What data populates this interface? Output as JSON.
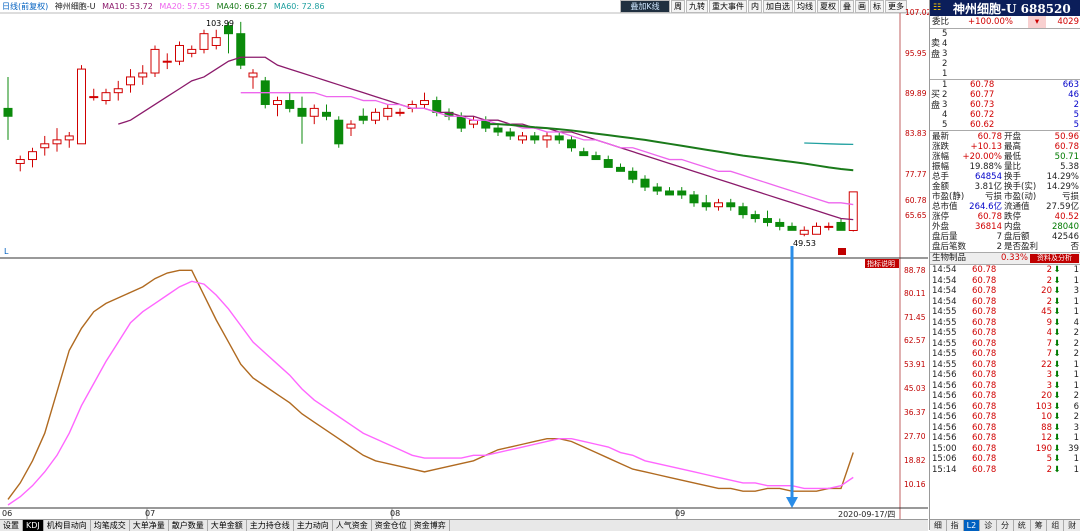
{
  "legend": {
    "period": "日线(前复权)",
    "stock": "神州细胞-U",
    "ma10": "MA10: 53.72",
    "ma20": "MA20: 57.55",
    "ma40": "MA40: 66.27",
    "ma60": "MA60: 72.86"
  },
  "toolbar": [
    "叠加K线",
    "周",
    "九转",
    "重大事件",
    "内",
    "加自选",
    "均线",
    "夏权",
    "叠",
    "画",
    "标",
    "更多"
  ],
  "kline": {
    "y_ticks": [
      "107.02",
      "95.95",
      "89.89",
      "83.83",
      "77.77",
      "71.71",
      "65.65",
      "56.71",
      "60.78"
    ],
    "high_label": "103.99",
    "low_label": "49.53",
    "marker_l": "L"
  },
  "kdj": {
    "y_ticks": [
      "88.78",
      "80.11",
      "71.45",
      "62.57",
      "53.91",
      "45.03",
      "36.37",
      "27.70",
      "18.82",
      "10.16"
    ],
    "badge": "指标说明"
  },
  "x_axis": {
    "labels": [
      "06",
      "07",
      "08",
      "09"
    ],
    "date": "2020-09-17/四"
  },
  "bottom_tabs": [
    "设置",
    "KDJ",
    "机构目动向",
    "均笔成交",
    "大单净量",
    "散户数量",
    "大单金额",
    "主力持仓线",
    "主力动向",
    "人气资金",
    "资金仓位",
    "资金博弈"
  ],
  "right": {
    "title": "神州细胞-U 688520",
    "weibi": {
      "label": "委比",
      "pct": "+100.00%",
      "val": "4029"
    },
    "sell": [
      {
        "n": "5",
        "p": "",
        "v": ""
      },
      {
        "n": "4",
        "p": "",
        "v": ""
      },
      {
        "n": "3",
        "p": "",
        "v": ""
      },
      {
        "n": "2",
        "p": "",
        "v": ""
      },
      {
        "n": "1",
        "p": "",
        "v": ""
      }
    ],
    "buy": [
      {
        "n": "1",
        "p": "60.78",
        "v": "663"
      },
      {
        "n": "2",
        "p": "60.77",
        "v": "46"
      },
      {
        "n": "3",
        "p": "60.73",
        "v": "2"
      },
      {
        "n": "4",
        "p": "60.72",
        "v": "5"
      },
      {
        "n": "5",
        "p": "60.62",
        "v": "5"
      }
    ],
    "sell_label": "卖盘",
    "buy_label": "买盘",
    "stats": [
      [
        "最新",
        "60.78",
        "开盘",
        "50.96"
      ],
      [
        "涨跌",
        "+10.13",
        "最高",
        "60.78"
      ],
      [
        "涨幅",
        "+20.00%",
        "最低",
        "50.71"
      ],
      [
        "振幅",
        "19.88%",
        "量比",
        "5.38"
      ],
      [
        "总手",
        "64854",
        "换手",
        "14.29%"
      ],
      [
        "金额",
        "3.81亿",
        "换手(实)",
        "14.29%"
      ],
      [
        "市盈(静)",
        "亏损",
        "市盈(动)",
        "亏损"
      ],
      [
        "总市值",
        "264.6亿",
        "流通值",
        "27.59亿"
      ],
      [
        "涨停",
        "60.78",
        "跌停",
        "40.52"
      ],
      [
        "外盘",
        "36814",
        "内盘",
        "28040"
      ],
      [
        "盘后量",
        "7",
        "盘后额",
        "42546"
      ],
      [
        "盘后笔数",
        "2",
        "是否盈利",
        "否"
      ]
    ],
    "sector": {
      "name": "生物制品",
      "pct": "0.33%",
      "btn": "资料及分析"
    },
    "ticks": [
      [
        "14:54",
        "60.78",
        "2",
        "1"
      ],
      [
        "14:54",
        "60.78",
        "2",
        "1"
      ],
      [
        "14:54",
        "60.78",
        "20",
        "3"
      ],
      [
        "14:54",
        "60.78",
        "2",
        "1"
      ],
      [
        "14:55",
        "60.78",
        "45",
        "1"
      ],
      [
        "14:55",
        "60.78",
        "9",
        "4"
      ],
      [
        "14:55",
        "60.78",
        "4",
        "2"
      ],
      [
        "14:55",
        "60.78",
        "7",
        "2"
      ],
      [
        "14:55",
        "60.78",
        "7",
        "2"
      ],
      [
        "14:55",
        "60.78",
        "22",
        "1"
      ],
      [
        "14:56",
        "60.78",
        "3",
        "1"
      ],
      [
        "14:56",
        "60.78",
        "3",
        "1"
      ],
      [
        "14:56",
        "60.78",
        "20",
        "2"
      ],
      [
        "14:56",
        "60.78",
        "103",
        "6"
      ],
      [
        "14:56",
        "60.78",
        "10",
        "2"
      ],
      [
        "14:56",
        "60.78",
        "88",
        "3"
      ],
      [
        "14:56",
        "60.78",
        "12",
        "1"
      ],
      [
        "15:00",
        "60.78",
        "190",
        "39"
      ],
      [
        "15:06",
        "60.78",
        "5",
        "1"
      ],
      [
        "15:14",
        "60.78",
        "2",
        "1"
      ]
    ],
    "tabs": [
      "细",
      "指",
      "L2",
      "诊",
      "分",
      "统",
      "筹",
      "组",
      "财"
    ]
  },
  "chart_data": [
    {
      "type": "candlestick",
      "title": "",
      "ylim": [
        46,
        107.02
      ],
      "candles": [
        [
          82,
          90,
          74,
          80
        ],
        [
          68,
          66,
          70,
          69
        ],
        [
          69,
          72,
          67,
          71
        ],
        [
          72,
          75,
          70,
          73
        ],
        [
          73,
          77,
          71,
          74
        ],
        [
          74,
          76,
          72,
          75
        ],
        [
          73,
          93,
          73,
          92
        ],
        [
          85,
          87,
          84,
          85
        ],
        [
          84,
          87,
          83,
          86
        ],
        [
          86,
          89,
          84,
          87
        ],
        [
          88,
          92,
          86,
          90
        ],
        [
          90,
          93,
          88,
          91
        ],
        [
          91,
          98,
          90,
          97
        ],
        [
          94,
          96,
          92,
          94
        ],
        [
          94,
          99,
          93,
          98
        ],
        [
          96,
          98,
          95,
          97
        ],
        [
          97,
          102,
          96,
          101
        ],
        [
          98,
          102,
          97,
          100
        ],
        [
          103,
          104,
          96,
          101
        ],
        [
          101,
          104,
          92,
          93
        ],
        [
          90,
          92,
          87,
          91
        ],
        [
          89,
          90,
          82,
          83
        ],
        [
          83,
          85,
          80,
          84
        ],
        [
          84,
          86,
          81,
          82
        ],
        [
          82,
          85,
          73,
          80
        ],
        [
          80,
          83,
          78,
          82
        ],
        [
          81,
          83,
          79,
          80
        ],
        [
          79,
          80,
          72,
          73
        ],
        [
          77,
          79,
          75,
          78
        ],
        [
          80,
          82,
          78,
          79
        ],
        [
          79,
          82,
          78,
          81
        ],
        [
          80,
          83,
          79,
          82
        ],
        [
          81,
          82,
          80,
          81
        ],
        [
          82,
          84,
          81,
          83
        ],
        [
          83,
          86,
          82,
          84
        ],
        [
          84,
          85,
          80,
          81
        ],
        [
          81,
          82,
          79,
          80
        ],
        [
          80,
          81,
          76,
          77
        ],
        [
          78,
          80,
          77,
          79
        ],
        [
          79,
          80,
          76,
          77
        ],
        [
          77,
          78,
          75,
          76
        ],
        [
          76,
          77,
          74,
          75
        ],
        [
          74,
          76,
          73,
          75
        ],
        [
          75,
          76,
          73,
          74
        ],
        [
          74,
          76,
          72,
          75
        ],
        [
          75,
          76,
          73,
          74
        ],
        [
          74,
          75,
          71,
          72
        ],
        [
          71,
          72,
          70,
          70
        ],
        [
          70,
          71,
          69,
          69
        ],
        [
          69,
          70,
          67,
          67
        ],
        [
          67,
          68,
          66,
          66
        ],
        [
          66,
          67,
          63,
          64
        ],
        [
          64,
          65,
          61,
          62
        ],
        [
          62,
          63,
          60,
          61
        ],
        [
          61,
          62,
          60,
          60
        ],
        [
          61,
          62,
          59,
          60
        ],
        [
          60,
          61,
          57,
          58
        ],
        [
          58,
          60,
          56,
          57
        ],
        [
          57,
          59,
          56,
          58
        ],
        [
          58,
          59,
          56,
          57
        ],
        [
          57,
          58,
          54,
          55
        ],
        [
          55,
          56,
          53,
          54
        ],
        [
          54,
          56,
          52,
          53
        ],
        [
          53,
          54,
          51,
          52
        ],
        [
          52,
          53,
          51,
          51
        ],
        [
          50,
          52,
          49.5,
          51
        ],
        [
          50,
          53,
          50,
          52
        ],
        [
          52,
          53,
          51,
          52
        ],
        [
          53,
          54,
          51,
          51
        ],
        [
          50.96,
          60.78,
          50.71,
          60.78
        ]
      ],
      "series": [
        {
          "name": "MA10",
          "color": "#8b1a6b",
          "values": [
            null,
            null,
            null,
            null,
            null,
            null,
            null,
            null,
            null,
            78,
            79,
            81,
            83,
            85,
            87,
            89,
            90,
            92,
            94,
            95,
            95,
            95,
            93,
            92,
            91,
            90,
            89,
            88,
            87,
            86,
            85,
            84,
            83,
            82,
            82,
            81,
            81,
            80,
            80,
            79,
            79,
            78,
            78,
            77,
            77,
            76,
            76,
            75,
            74,
            73,
            72,
            71,
            70,
            69,
            68,
            67,
            66,
            65,
            64,
            63,
            62,
            61,
            60,
            59,
            58,
            57,
            56,
            55,
            54,
            53.72
          ]
        },
        {
          "name": "MA20",
          "color": "#ee66ee",
          "values": [
            null,
            null,
            null,
            null,
            null,
            null,
            null,
            null,
            null,
            null,
            null,
            null,
            null,
            null,
            null,
            null,
            null,
            null,
            null,
            86,
            86,
            86,
            86,
            86,
            86,
            86,
            85,
            85,
            85,
            84,
            84,
            83,
            83,
            82,
            82,
            81,
            80,
            80,
            79,
            79,
            78,
            78,
            77,
            77,
            76,
            76,
            75,
            74,
            74,
            73,
            72,
            72,
            71,
            70,
            69,
            69,
            68,
            67,
            66,
            66,
            65,
            64,
            63,
            62,
            61,
            60,
            59,
            58,
            58,
            57.55
          ]
        },
        {
          "name": "MA40",
          "color": "#1a7a1a",
          "values": [
            null,
            null,
            null,
            null,
            null,
            null,
            null,
            null,
            null,
            null,
            null,
            null,
            null,
            null,
            null,
            null,
            null,
            null,
            null,
            null,
            null,
            null,
            null,
            null,
            null,
            null,
            null,
            null,
            null,
            null,
            null,
            null,
            null,
            null,
            null,
            null,
            null,
            null,
            null,
            78,
            78,
            77.8,
            77.5,
            77.2,
            77,
            76.7,
            76.4,
            76,
            75.6,
            75.2,
            74.8,
            74.4,
            74,
            73.5,
            73,
            72.5,
            72,
            71.5,
            71,
            70.5,
            70,
            69.6,
            69.2,
            68.8,
            68.4,
            68,
            67.5,
            67,
            66.6,
            66.27
          ]
        },
        {
          "name": "MA60",
          "color": "#20a0a0",
          "values": [
            null,
            null,
            null,
            null,
            null,
            null,
            null,
            null,
            null,
            null,
            null,
            null,
            null,
            null,
            null,
            null,
            null,
            null,
            null,
            null,
            null,
            null,
            null,
            null,
            null,
            null,
            null,
            null,
            null,
            null,
            null,
            null,
            null,
            null,
            null,
            null,
            null,
            null,
            null,
            null,
            null,
            null,
            null,
            null,
            null,
            null,
            null,
            null,
            null,
            null,
            null,
            null,
            null,
            null,
            null,
            null,
            null,
            null,
            null,
            null,
            null,
            null,
            null,
            null,
            null,
            73.2,
            73.1,
            73,
            72.9,
            72.86
          ]
        }
      ]
    },
    {
      "type": "line",
      "title": "",
      "ylim": [
        4,
        92
      ],
      "series": [
        {
          "name": "K",
          "color": "#b06a20",
          "values": [
            6,
            12,
            20,
            30,
            45,
            60,
            68,
            74,
            77,
            79,
            81,
            83,
            86,
            88,
            89,
            89,
            80,
            71,
            63,
            55,
            50,
            47,
            44,
            41,
            37,
            34,
            31,
            28,
            25,
            22,
            20,
            19,
            18,
            17,
            16,
            17,
            18,
            19,
            20,
            22,
            24,
            25,
            26,
            27,
            28,
            28,
            27,
            25,
            23,
            21,
            19,
            17,
            16,
            15,
            14,
            13,
            12,
            11,
            10,
            10,
            9,
            9,
            10,
            10,
            9,
            9,
            9,
            10,
            10,
            23
          ]
        },
        {
          "name": "D",
          "color": "#ff66ff",
          "values": [
            4,
            7,
            11,
            16,
            22,
            30,
            40,
            48,
            56,
            63,
            70,
            74,
            77,
            80,
            83,
            85,
            84,
            80,
            75,
            69,
            63,
            59,
            55,
            51,
            46,
            42,
            39,
            36,
            33,
            30,
            28,
            26,
            24,
            22,
            21,
            21,
            21,
            21,
            22,
            22,
            23,
            24,
            25,
            26,
            27,
            28,
            28,
            27,
            26,
            25,
            23,
            22,
            20,
            19,
            18,
            17,
            16,
            15,
            14,
            13,
            12,
            12,
            11,
            11,
            11,
            10,
            10,
            10,
            11,
            14
          ]
        }
      ]
    }
  ]
}
